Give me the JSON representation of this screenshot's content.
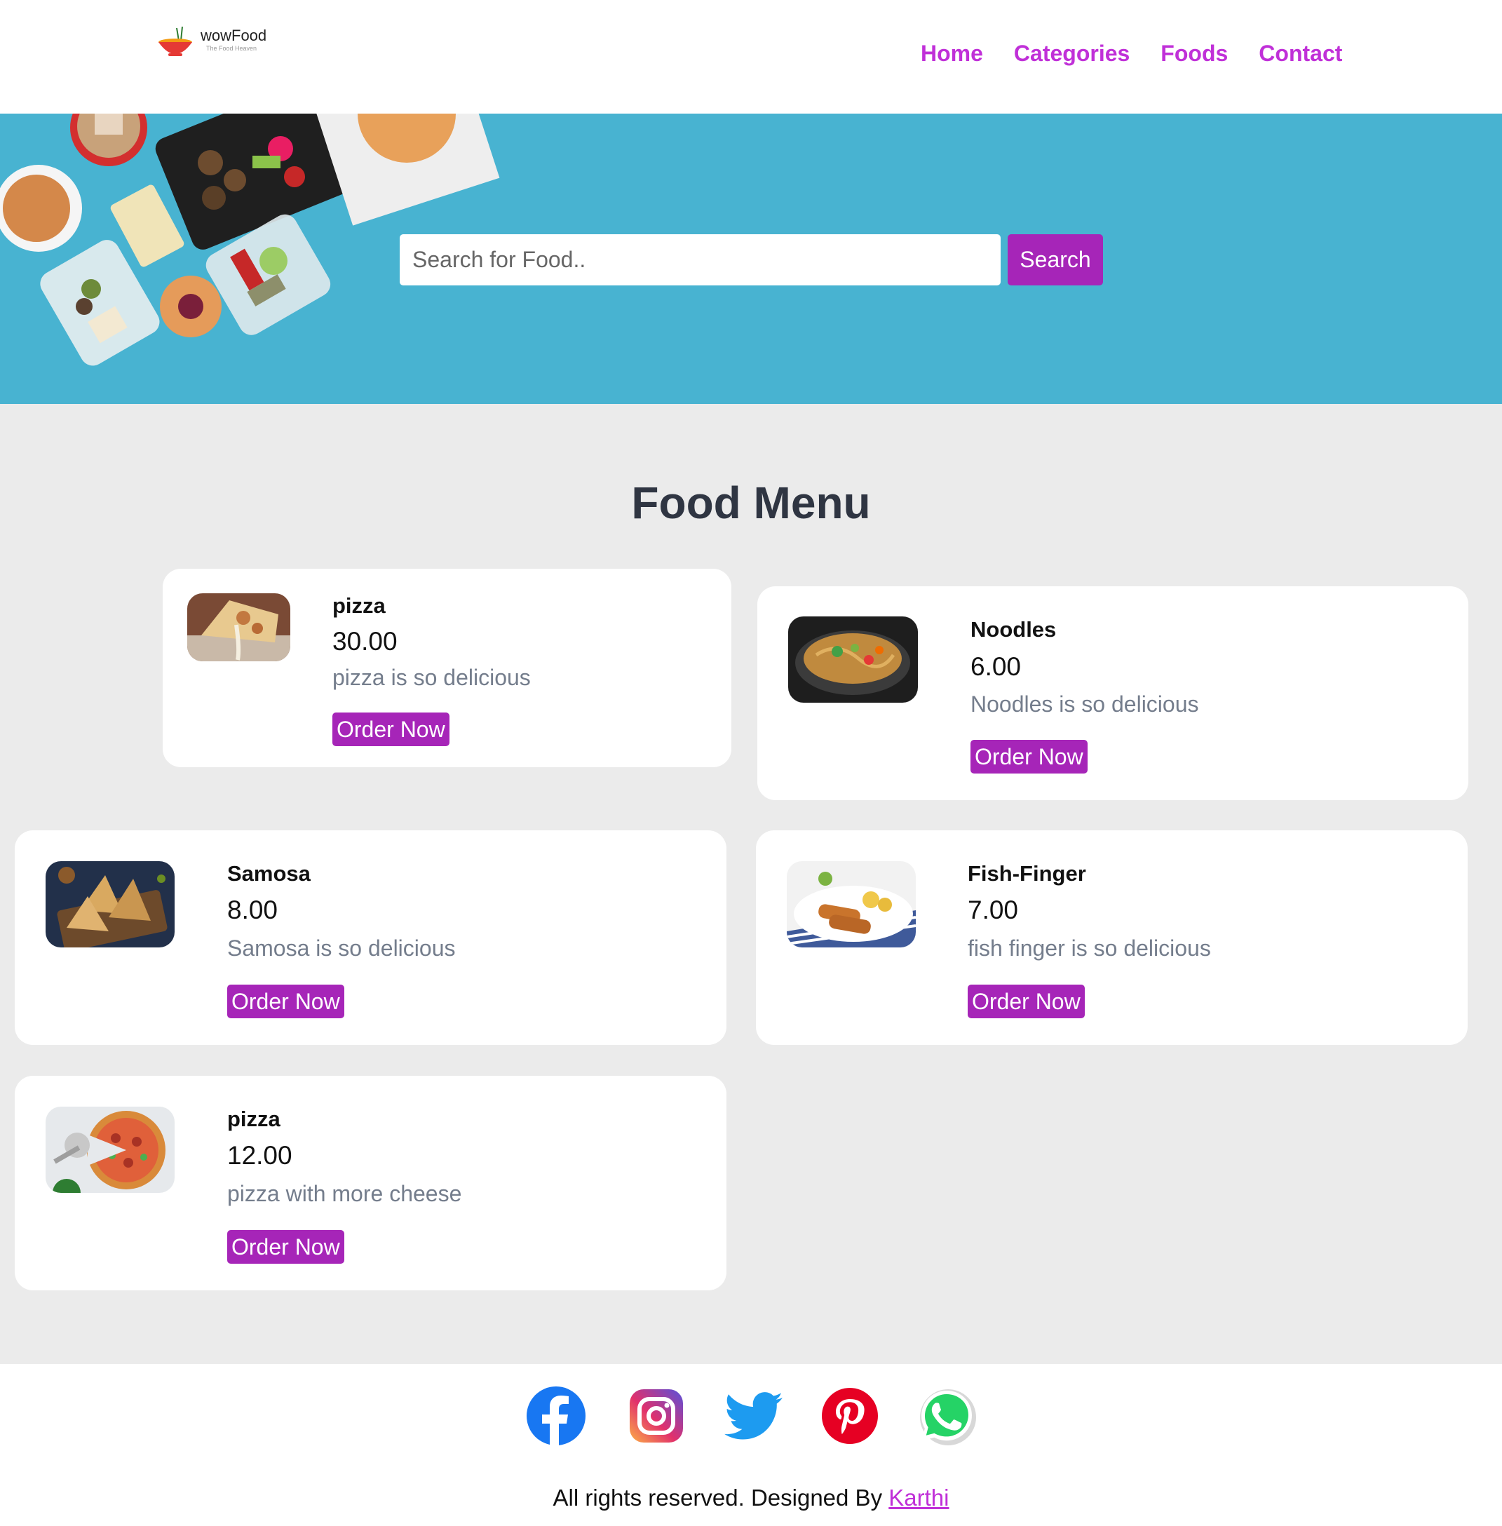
{
  "brand": {
    "name": "wowFood",
    "tagline": "The Food Heaven"
  },
  "nav": [
    {
      "label": "Home"
    },
    {
      "label": "Categories"
    },
    {
      "label": "Foods"
    },
    {
      "label": "Contact"
    }
  ],
  "search": {
    "placeholder": "Search for Food..",
    "value": "",
    "button_label": "Search"
  },
  "menu": {
    "title": "Food Menu",
    "items": [
      {
        "name": "pizza",
        "price": "30.00",
        "description": "pizza is so delicious",
        "button": "Order Now"
      },
      {
        "name": "Noodles",
        "price": "6.00",
        "description": "Noodles is so delicious",
        "button": "Order Now"
      },
      {
        "name": "Samosa",
        "price": "8.00",
        "description": "Samosa is so delicious",
        "button": "Order Now"
      },
      {
        "name": "Fish-Finger",
        "price": "7.00",
        "description": "fish finger is so delicious",
        "button": "Order Now"
      },
      {
        "name": "pizza",
        "price": "12.00",
        "description": "pizza with more cheese",
        "button": "Order Now"
      }
    ]
  },
  "footer": {
    "social": [
      {
        "icon": "facebook-icon"
      },
      {
        "icon": "instagram-icon"
      },
      {
        "icon": "twitter-icon"
      },
      {
        "icon": "pinterest-icon"
      },
      {
        "icon": "whatsapp-icon"
      }
    ],
    "copyright": "All rights reserved. Designed By ",
    "credit": "Karthi"
  },
  "colors": {
    "accent": "#c030d8",
    "button": "#a625b8",
    "hero": "#48b3d1",
    "background": "#ebebeb"
  }
}
